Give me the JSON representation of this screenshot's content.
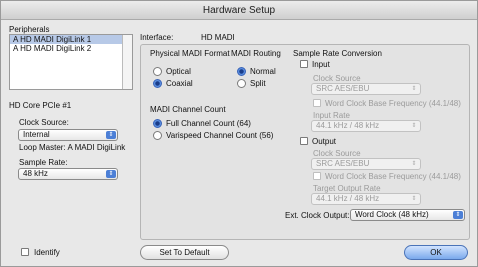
{
  "window": {
    "title": "Hardware Setup"
  },
  "peripherals": {
    "label": "Peripherals",
    "items": [
      {
        "label": "A HD MADI DigiLink 1",
        "selected": true
      },
      {
        "label": "A HD MADI DigiLink 2",
        "selected": false
      }
    ]
  },
  "card": {
    "name": "HD Core PCIe #1",
    "clock_source_label": "Clock Source:",
    "clock_source_value": "Internal",
    "loop_master": "Loop Master: A MADI DigiLink",
    "sample_rate_label": "Sample Rate:",
    "sample_rate_value": "48 kHz"
  },
  "interface": {
    "label": "Interface:",
    "value": "HD MADI"
  },
  "madi_physical_format": {
    "label": "Physical MADI Format",
    "options": [
      {
        "label": "Optical",
        "selected": false
      },
      {
        "label": "Coaxial",
        "selected": true
      }
    ]
  },
  "madi_routing": {
    "label": "MADI Routing",
    "options": [
      {
        "label": "Normal",
        "selected": true
      },
      {
        "label": "Split",
        "selected": false
      }
    ]
  },
  "madi_channel_count": {
    "label": "MADI Channel Count",
    "options": [
      {
        "label": "Full Channel Count (64)",
        "selected": true
      },
      {
        "label": "Varispeed Channel Count (56)",
        "selected": false
      }
    ]
  },
  "src": {
    "label": "Sample Rate Conversion",
    "input": {
      "label": "Input",
      "checked": false,
      "clock_source_label": "Clock Source",
      "clock_source_value": "SRC AES/EBU",
      "word_clock_label": "Word Clock Base Frequency (44.1/48)",
      "rate_label": "Input Rate",
      "rate_value": "44.1 kHz / 48 kHz"
    },
    "output": {
      "label": "Output",
      "checked": false,
      "clock_source_label": "Clock Source",
      "clock_source_value": "SRC AES/EBU",
      "word_clock_label": "Word Clock Base Frequency (44.1/48)",
      "rate_label": "Target Output Rate",
      "rate_value": "44.1 kHz / 48 kHz"
    }
  },
  "ext_clock": {
    "label": "Ext. Clock Output:",
    "value": "Word Clock (48 kHz)"
  },
  "footer": {
    "identify_label": "Identify",
    "default_label": "Set To Default",
    "ok_label": "OK"
  },
  "colors": {
    "accent": "#4c7fd6",
    "selection": "#b7c9e7",
    "window_bg": "#e8e8e8"
  },
  "icons": {
    "dropdown": "updown-arrows-icon"
  }
}
